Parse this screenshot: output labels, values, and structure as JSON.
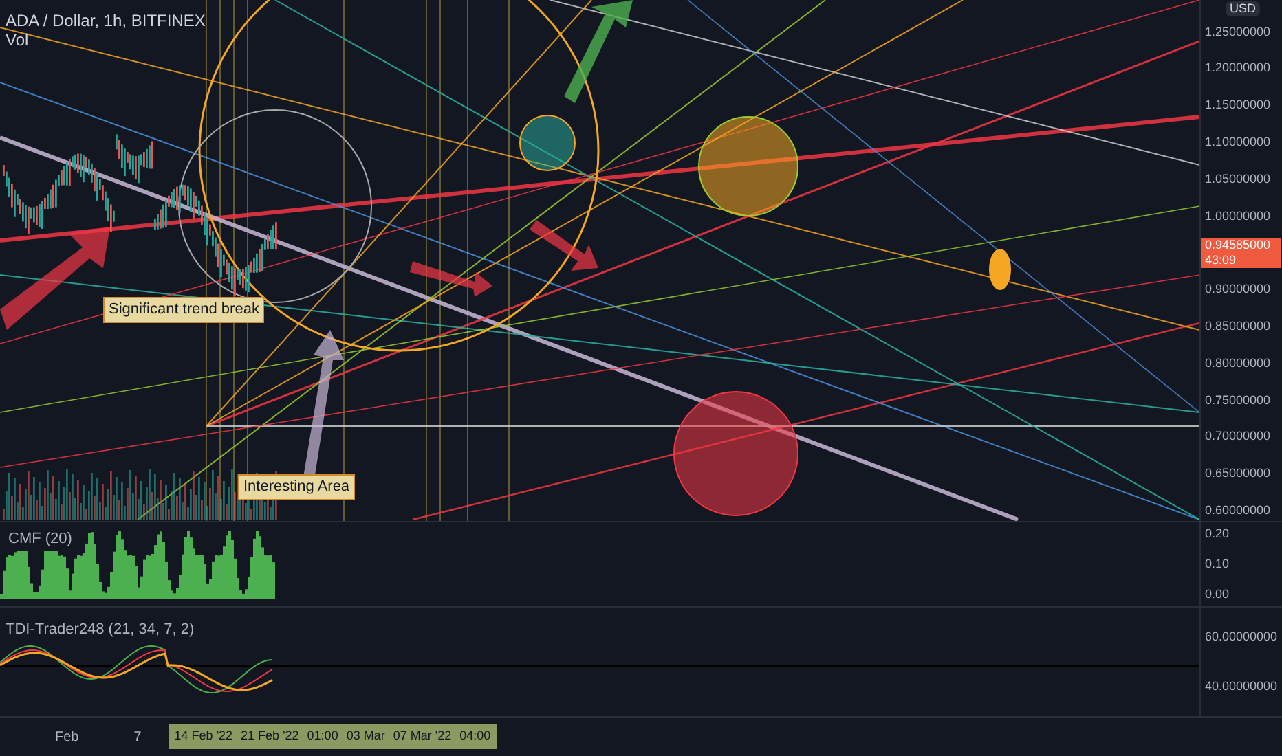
{
  "main_chart": {
    "title": "ADA / Dollar, 1h, BITFINEX",
    "volume_label": "Vol",
    "annotations": [
      {
        "text": "Significant trend break"
      },
      {
        "text": "Interesting Area"
      }
    ]
  },
  "price_axis": {
    "currency": "USD",
    "ticks": [
      "1.25000000",
      "1.20000000",
      "1.15000000",
      "1.10000000",
      "1.05000000",
      "1.00000000",
      "0.90000000",
      "0.85000000",
      "0.80000000",
      "0.75000000",
      "0.70000000",
      "0.65000000",
      "0.60000000"
    ],
    "current_price": "0.94585000",
    "countdown": "43:09"
  },
  "cmf_panel": {
    "title": "CMF (20)",
    "ticks": [
      "0.20",
      "0.10",
      "0.00"
    ]
  },
  "tdi_panel": {
    "title": "TDI-Trader248 (21, 34, 7, 2)",
    "ticks": [
      "60.00000000",
      "40.00000000"
    ]
  },
  "time_axis": {
    "labels": [
      "Feb",
      "7"
    ],
    "range_labels": [
      "14 Feb '22",
      "21 Feb '22",
      "01:00",
      "03 Mar",
      "07 Mar '22",
      "04:00"
    ]
  }
}
